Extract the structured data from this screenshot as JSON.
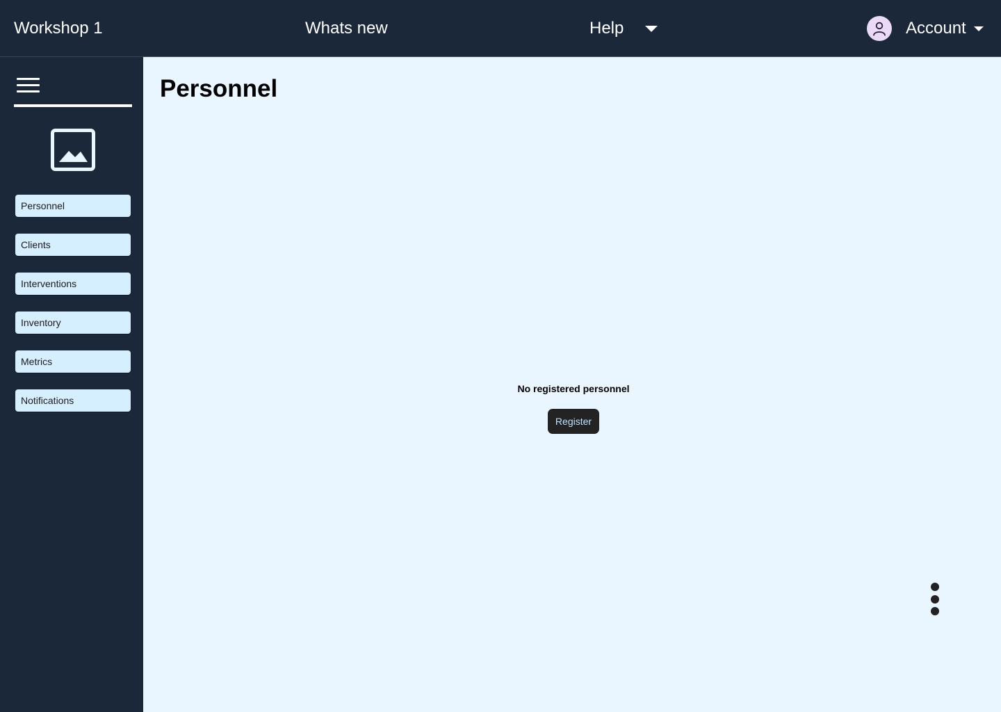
{
  "header": {
    "app_title": "Workshop 1",
    "whats_new_label": "Whats new",
    "help_label": "Help",
    "account_label": "Account"
  },
  "sidebar": {
    "items": [
      {
        "label": "Personnel"
      },
      {
        "label": "Clients"
      },
      {
        "label": "Interventions"
      },
      {
        "label": "Inventory"
      },
      {
        "label": "Metrics"
      },
      {
        "label": "Notifications"
      }
    ]
  },
  "main": {
    "title": "Personnel",
    "empty_state_text": "No registered personnel",
    "register_label": "Register"
  },
  "icons": {
    "menu": "hamburger-menu-icon",
    "logo": "image-placeholder-icon",
    "avatar": "user-avatar-icon",
    "more": "vertical-dots-icon"
  },
  "colors": {
    "header_bg": "#1b283a",
    "sidebar_bg": "#1b283a",
    "main_bg": "#eaf6ff",
    "nav_item_bg": "#d6efff",
    "register_button_bg": "#232323",
    "avatar_bg": "#ead9f7"
  }
}
